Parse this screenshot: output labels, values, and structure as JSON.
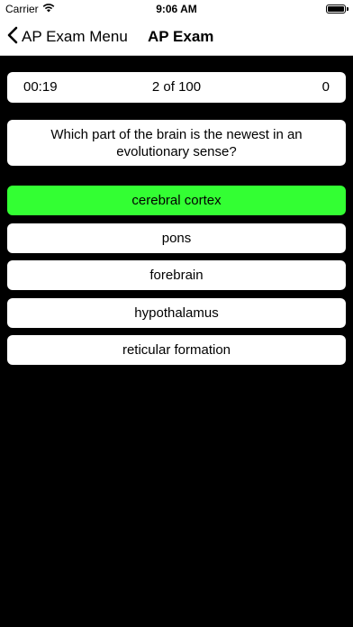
{
  "status_bar": {
    "carrier": "Carrier",
    "wifi_icon": "wifi-icon",
    "time": "9:06 AM",
    "battery_icon": "battery-icon"
  },
  "nav": {
    "back_label": "AP Exam Menu",
    "back_icon": "chevron-left-icon",
    "title": "AP Exam"
  },
  "info": {
    "timer": "00:19",
    "progress": "2 of 100",
    "score": "0"
  },
  "question": {
    "text": "Which part of the brain is the newest in an evolutionary sense?"
  },
  "answers": [
    {
      "label": "cerebral cortex",
      "state": "correct"
    },
    {
      "label": "pons",
      "state": "default"
    },
    {
      "label": "forebrain",
      "state": "default"
    },
    {
      "label": "hypothalamus",
      "state": "default"
    },
    {
      "label": "reticular formation",
      "state": "default"
    }
  ],
  "colors": {
    "background": "#000000",
    "card": "#ffffff",
    "correct": "#33ff33",
    "text": "#000000"
  }
}
